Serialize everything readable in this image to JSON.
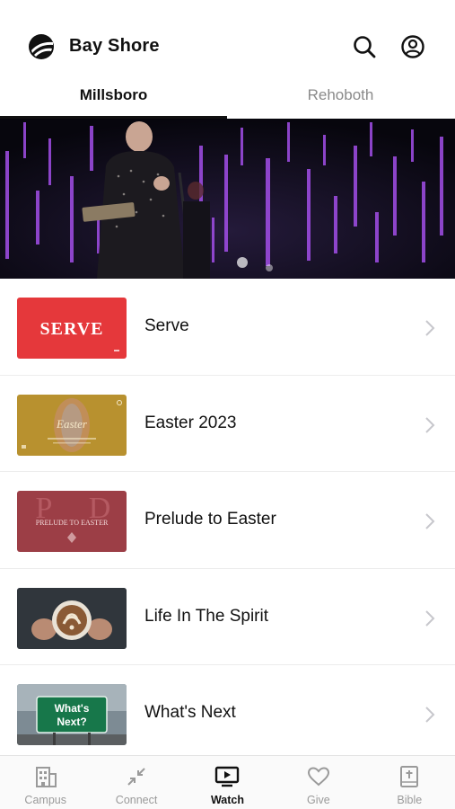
{
  "header": {
    "title": "Bay Shore",
    "logo_icon": "bay-shore-logo",
    "search_icon": "search-icon",
    "profile_icon": "user-circle-icon"
  },
  "campus_tabs": [
    {
      "label": "Millsboro",
      "selected": true
    },
    {
      "label": "Rehoboth",
      "selected": false
    }
  ],
  "hero": {
    "description_icon": "sermon-speaker-image"
  },
  "series": [
    {
      "title": "Serve",
      "thumb_text": "SERVE",
      "thumb_bg": "#e5383b"
    },
    {
      "title": "Easter 2023",
      "thumb_text": "Easter",
      "thumb_bg": "#b8912f"
    },
    {
      "title": "Prelude to Easter",
      "thumb_text": "PRELUDE TO EASTER",
      "thumb_bg": "#9c3e46"
    },
    {
      "title": "Life In The Spirit",
      "thumb_text": "",
      "thumb_bg": "#2a2f35"
    },
    {
      "title": "What's Next",
      "thumb_text": "What's Next?",
      "thumb_bg": "#7d8b94"
    }
  ],
  "tabbar": [
    {
      "label": "Campus",
      "icon": "building-icon",
      "active": false
    },
    {
      "label": "Connect",
      "icon": "arrows-inward-icon",
      "active": false
    },
    {
      "label": "Watch",
      "icon": "tv-play-icon",
      "active": true
    },
    {
      "label": "Give",
      "icon": "heart-icon",
      "active": false
    },
    {
      "label": "Bible",
      "icon": "bible-cross-icon",
      "active": false
    }
  ],
  "colors": {
    "text": "#111111",
    "muted": "#8a8a8a",
    "divider": "#ececec",
    "serve_red": "#e5383b",
    "easter_gold": "#b8912f",
    "prelude_red": "#9c3e46"
  }
}
